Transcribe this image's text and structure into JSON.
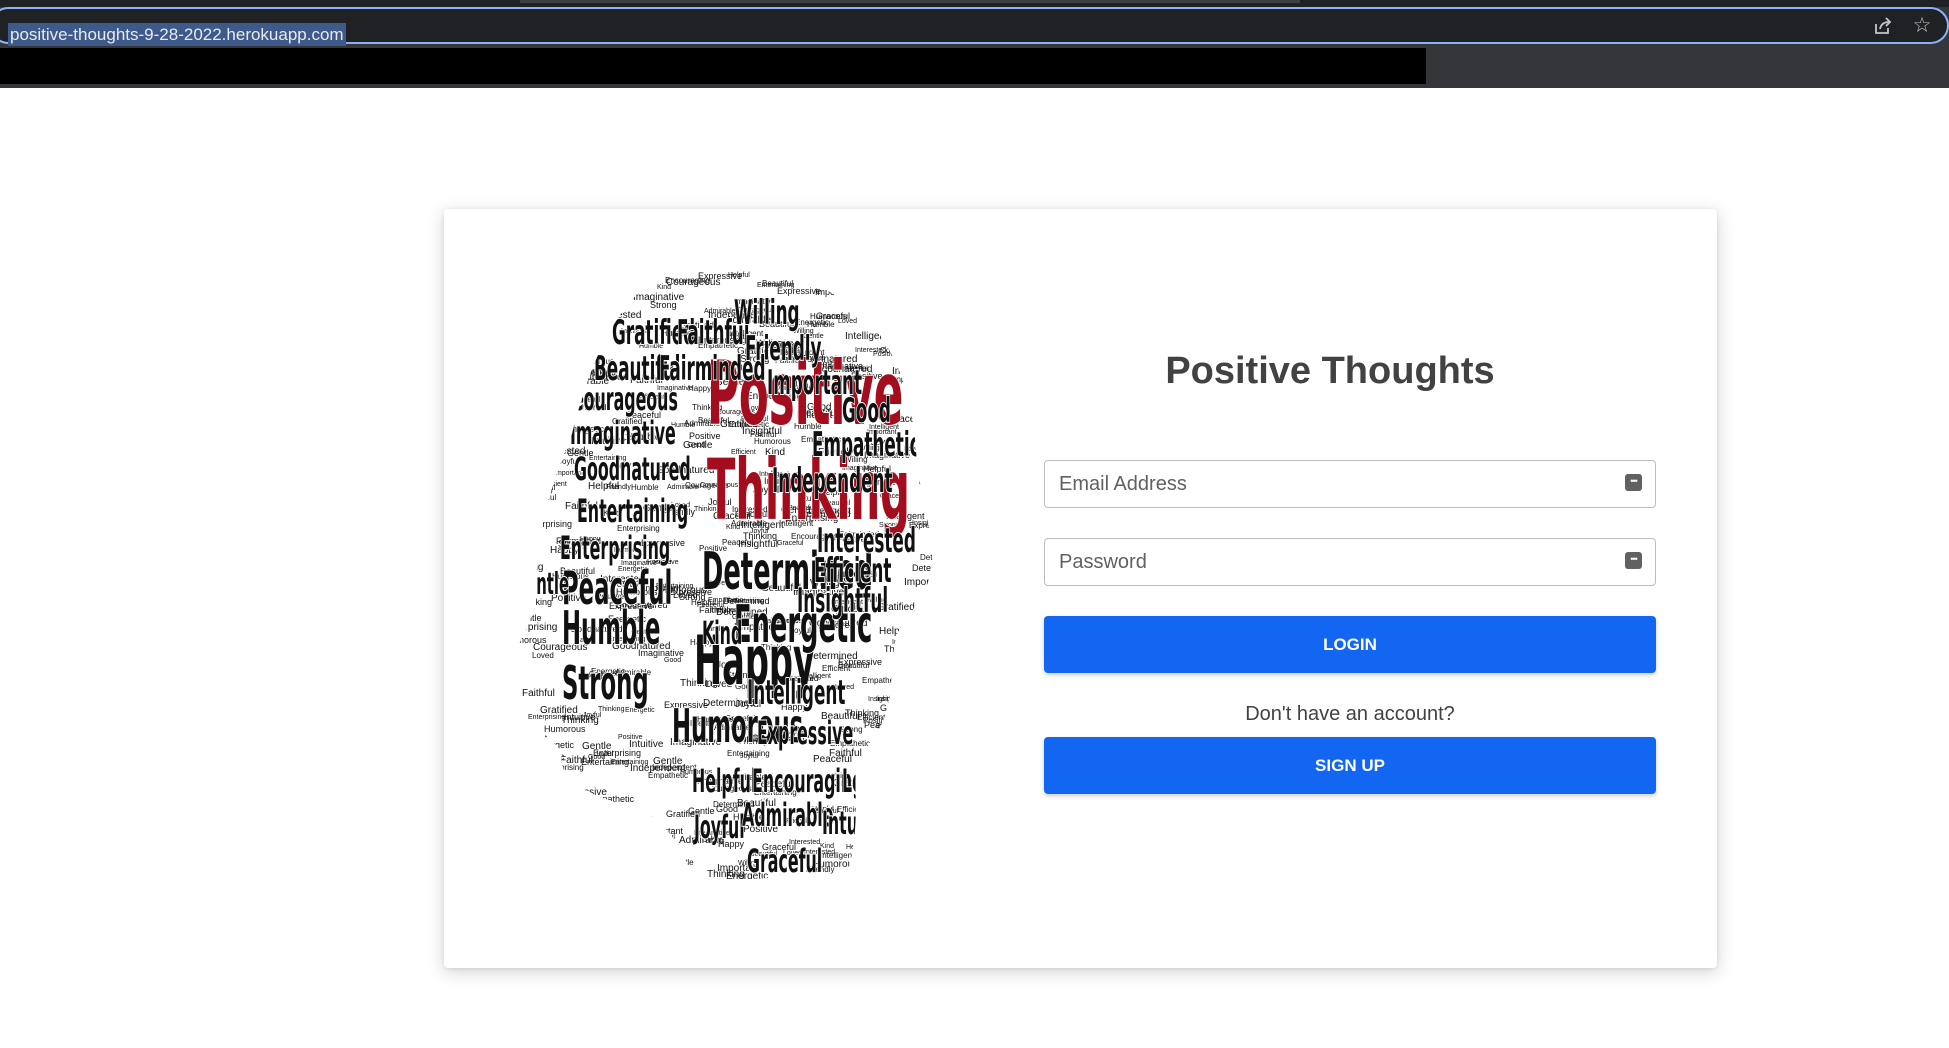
{
  "browser": {
    "url": "positive-thoughts-9-28-2022.herokuapp.com",
    "icons": [
      "share-icon",
      "star-icon"
    ]
  },
  "app": {
    "title": "Positive Thoughts",
    "email": {
      "placeholder": "Email Address",
      "value": ""
    },
    "password": {
      "placeholder": "Password",
      "value": ""
    },
    "login_label": "LOGIN",
    "no_account_text": "Don't have an account?",
    "signup_label": "SIGN UP"
  },
  "word_cloud": {
    "highlight_color": "#a30d1d",
    "words": [
      "Positive",
      "Thinking",
      "Happy",
      "Determined",
      "Energetic",
      "Peaceful",
      "Humble",
      "Strong",
      "Humorous",
      "Gratified",
      "Faithful",
      "Willing",
      "Friendly",
      "Beautiful",
      "Fairminded",
      "Important",
      "Courageous",
      "Good",
      "Imaginative",
      "Empathetic",
      "Goodnatured",
      "Independent",
      "Entertaining",
      "Interested",
      "Enterprising",
      "Efficient",
      "Gentle",
      "Insightful",
      "Kind",
      "Intelligent",
      "Expressive",
      "Helpful",
      "Encouraging",
      "Loved",
      "Joyful",
      "Admirable",
      "Intuitive",
      "Graceful"
    ]
  }
}
